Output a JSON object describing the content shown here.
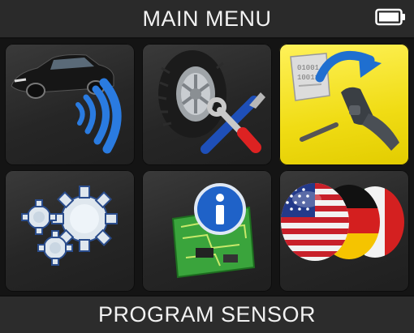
{
  "header": {
    "title": "MAIN MENU",
    "battery_icon": "battery-icon"
  },
  "menu": {
    "tiles": [
      {
        "icon": "vehicle-signal-icon"
      },
      {
        "icon": "tire-tools-icon"
      },
      {
        "icon": "program-sensor-icon",
        "selected": true
      },
      {
        "icon": "settings-gears-icon"
      },
      {
        "icon": "info-circuit-icon"
      },
      {
        "icon": "language-flags-icon"
      }
    ]
  },
  "footer": {
    "selected_label": "PROGRAM SENSOR"
  },
  "colors": {
    "selected_tile": "#f2de16",
    "signal_wave": "#2a7be0",
    "info_blue": "#1f62c8"
  }
}
